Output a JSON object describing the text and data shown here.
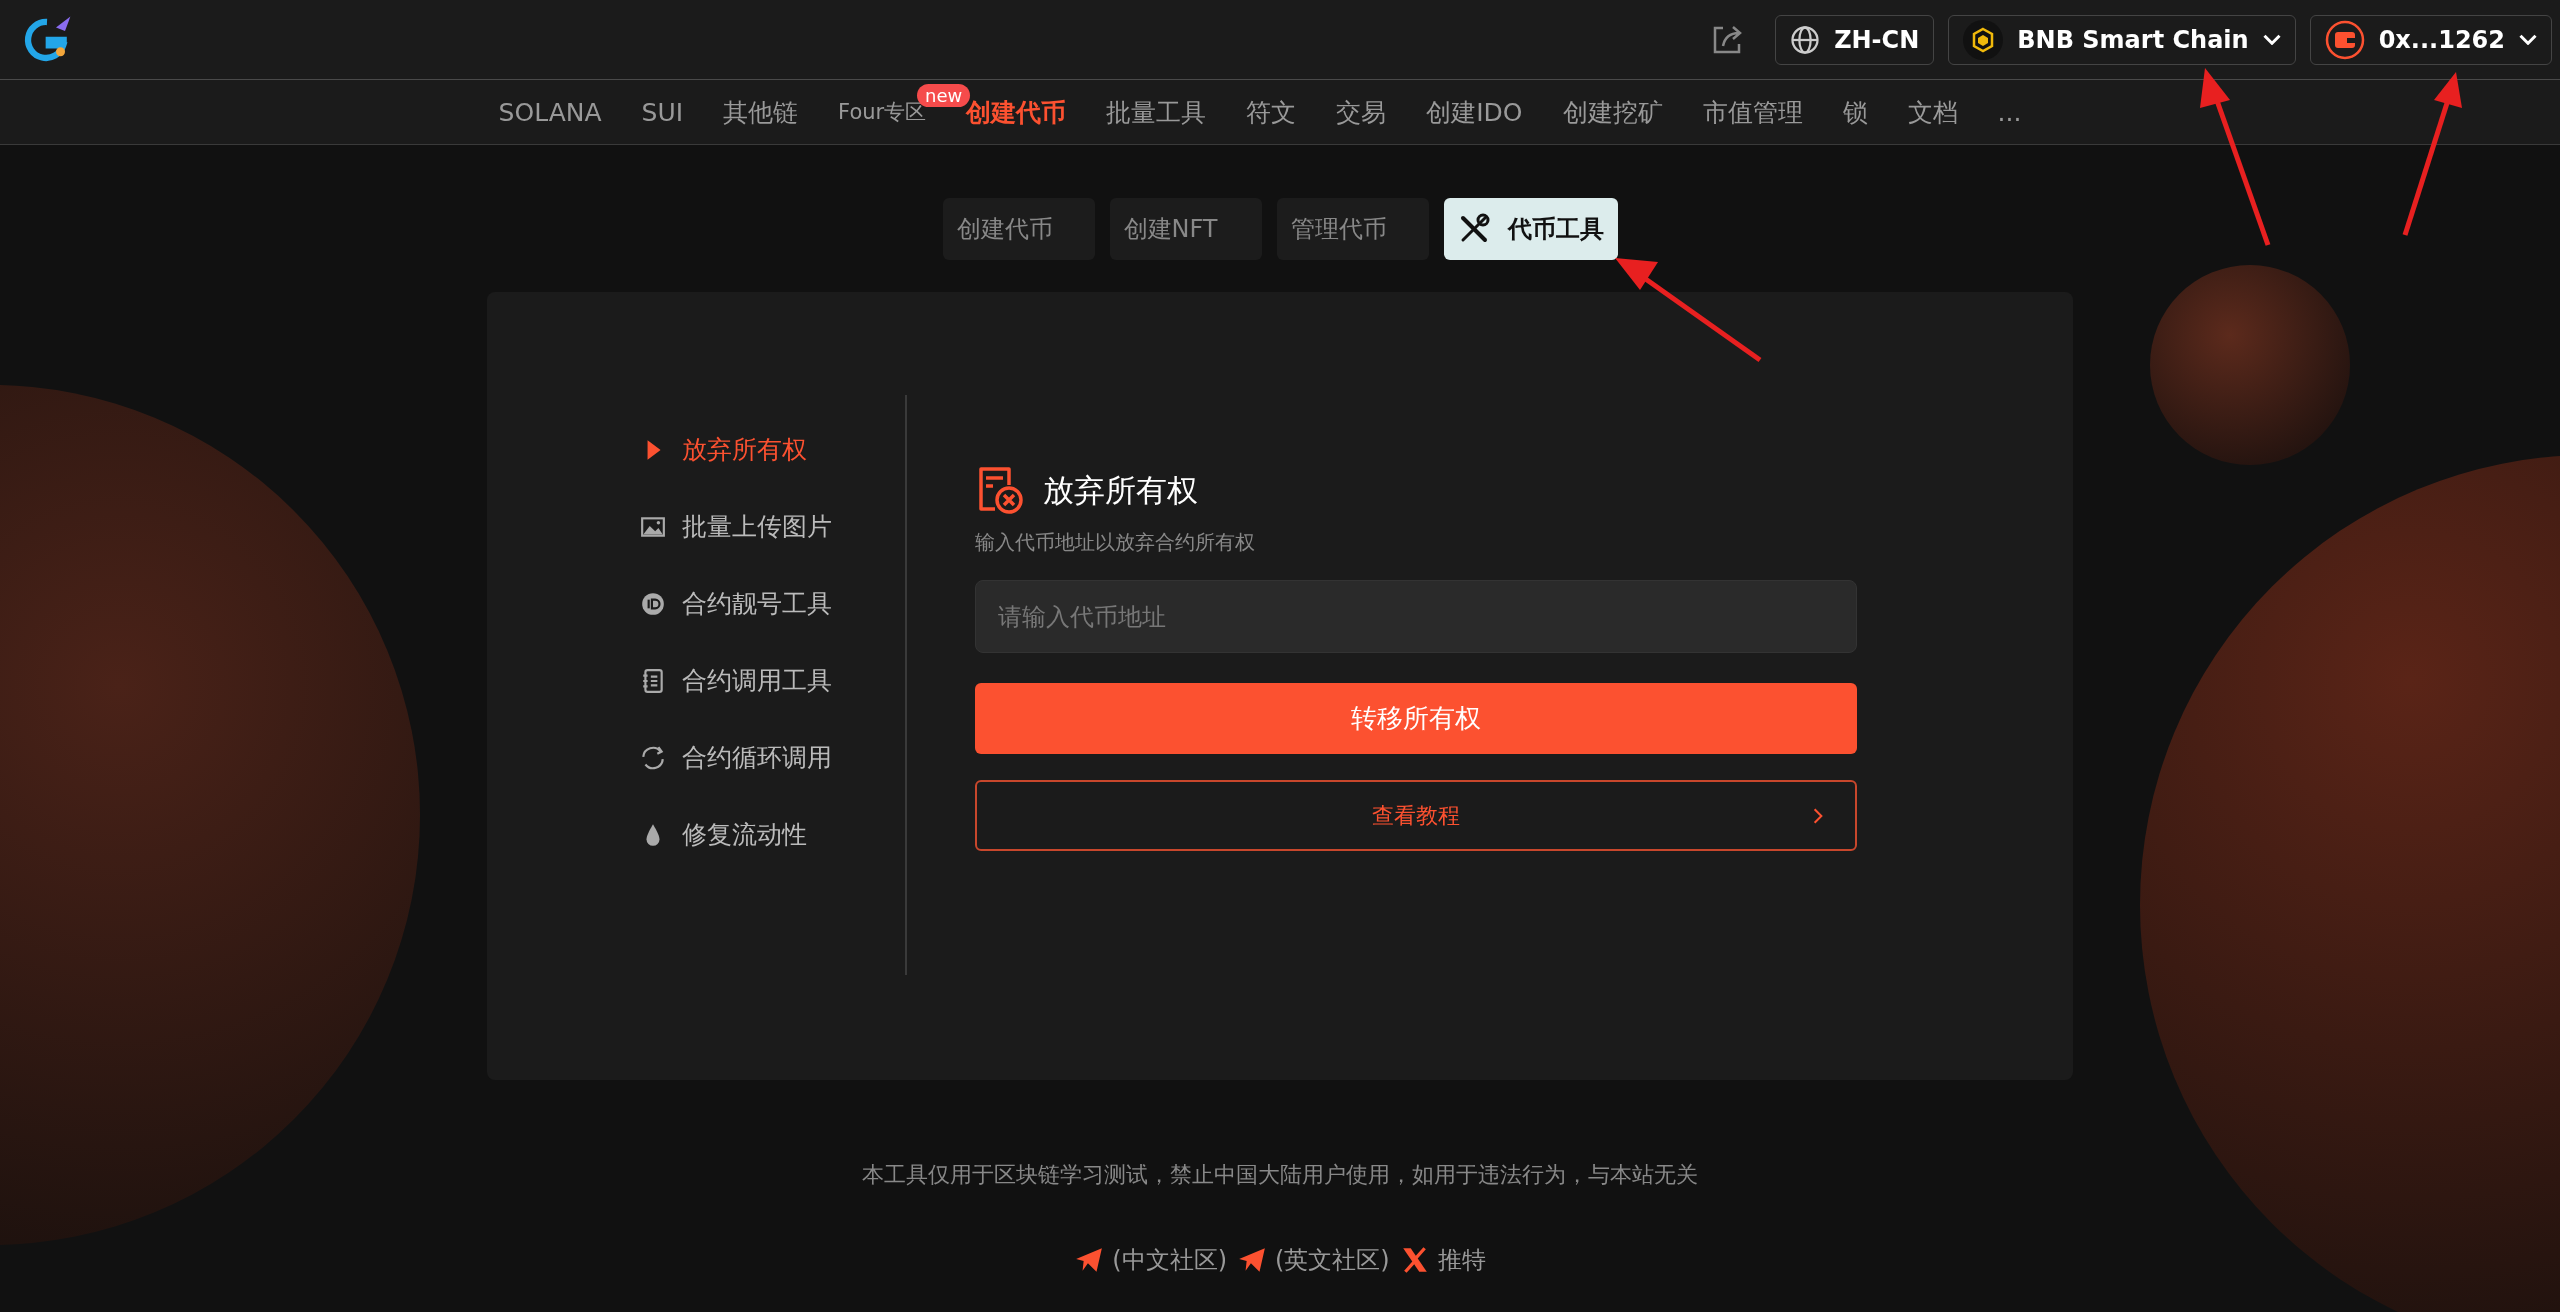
{
  "header": {
    "language": "ZH-CN",
    "network": "BNB Smart Chain",
    "wallet": "0x...1262"
  },
  "nav": [
    {
      "label": "SOLANA",
      "selected": false
    },
    {
      "label": "SUI",
      "selected": false
    },
    {
      "label": "其他链",
      "selected": false
    },
    {
      "label": "Four专区",
      "selected": false,
      "badge": "new"
    },
    {
      "label": "创建代币",
      "selected": true
    },
    {
      "label": "批量工具",
      "selected": false
    },
    {
      "label": "符文",
      "selected": false
    },
    {
      "label": "交易",
      "selected": false
    },
    {
      "label": "创建IDO",
      "selected": false
    },
    {
      "label": "创建挖矿",
      "selected": false
    },
    {
      "label": "市值管理",
      "selected": false
    },
    {
      "label": "锁",
      "selected": false
    },
    {
      "label": "文档",
      "selected": false
    },
    {
      "label": "...",
      "selected": false
    }
  ],
  "tabs": [
    {
      "label": "创建代币",
      "selected": false
    },
    {
      "label": "创建NFT",
      "selected": false
    },
    {
      "label": "管理代币",
      "selected": false
    },
    {
      "label": "代币工具",
      "selected": true
    }
  ],
  "sidebar": [
    {
      "label": "放弃所有权",
      "selected": true
    },
    {
      "label": "批量上传图片",
      "selected": false
    },
    {
      "label": "合约靓号工具",
      "selected": false
    },
    {
      "label": "合约调用工具",
      "selected": false
    },
    {
      "label": "合约循环调用",
      "selected": false
    },
    {
      "label": "修复流动性",
      "selected": false
    }
  ],
  "panel": {
    "title": "放弃所有权",
    "subtitle": "输入代币地址以放弃合约所有权",
    "address_field": {
      "placeholder": "请输入代币地址"
    },
    "submit_button": "转移所有权",
    "tutorial_link": "查看教程"
  },
  "footer": {
    "disclaimer": "本工具仅用于区块链学习测试，禁止中国大陆用户使用，如用于违法行为，与本站无关",
    "links": [
      {
        "label": "(中文社区)"
      },
      {
        "label": "(英文社区)"
      },
      {
        "label": "推特"
      }
    ]
  }
}
